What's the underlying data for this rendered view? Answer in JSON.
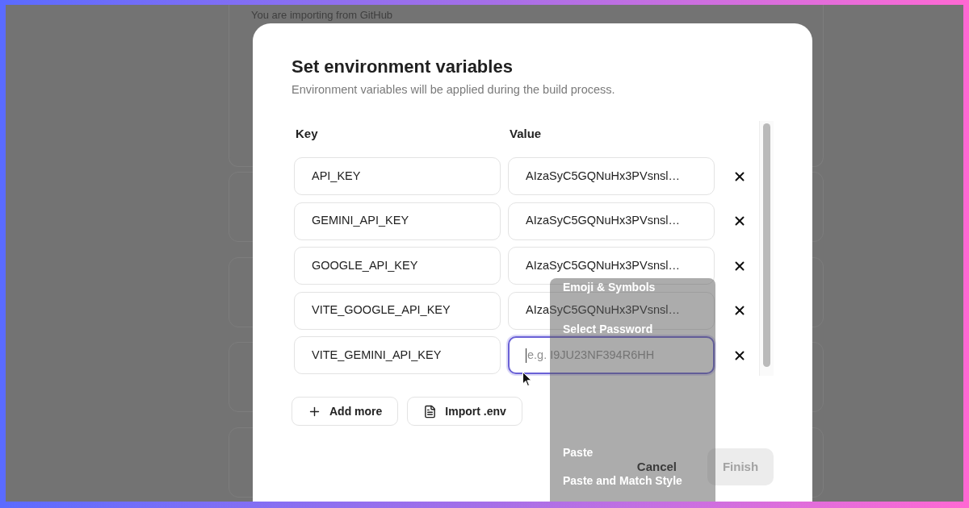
{
  "background_page": {
    "notice": "You are importing from GitHub"
  },
  "dialog": {
    "title": "Set environment variables",
    "subtitle": "Environment variables will be applied during the build process.",
    "columns": [
      "Key",
      "Value"
    ],
    "variables": [
      {
        "key": "API_KEY",
        "value": "AIzaSyC5GQNuHx3PVsnsl…",
        "focused": false
      },
      {
        "key": "GEMINI_API_KEY",
        "value": "AIzaSyC5GQNuHx3PVsnsl…",
        "focused": false
      },
      {
        "key": "GOOGLE_API_KEY",
        "value": "AIzaSyC5GQNuHx3PVsnsl…",
        "focused": false
      },
      {
        "key": "VITE_GOOGLE_API_KEY",
        "value": "AIzaSyC5GQNuHx3PVsnsl…",
        "focused": false
      },
      {
        "key": "VITE_GEMINI_API_KEY",
        "placeholder": "e.g. I9JU23NF394R6HH",
        "focused": true
      }
    ],
    "actions": [
      {
        "kind": "add",
        "label": "Add more"
      },
      {
        "kind": "import",
        "label": "Import .env"
      }
    ],
    "footer": {
      "cancel": "Cancel",
      "finish": {
        "label": "Finish",
        "disabled": true
      }
    }
  },
  "context_menu": {
    "groups": [
      [
        "Emoji & Symbols",
        "Select Password"
      ],
      [
        "Paste",
        "Paste and Match Style"
      ]
    ]
  }
}
